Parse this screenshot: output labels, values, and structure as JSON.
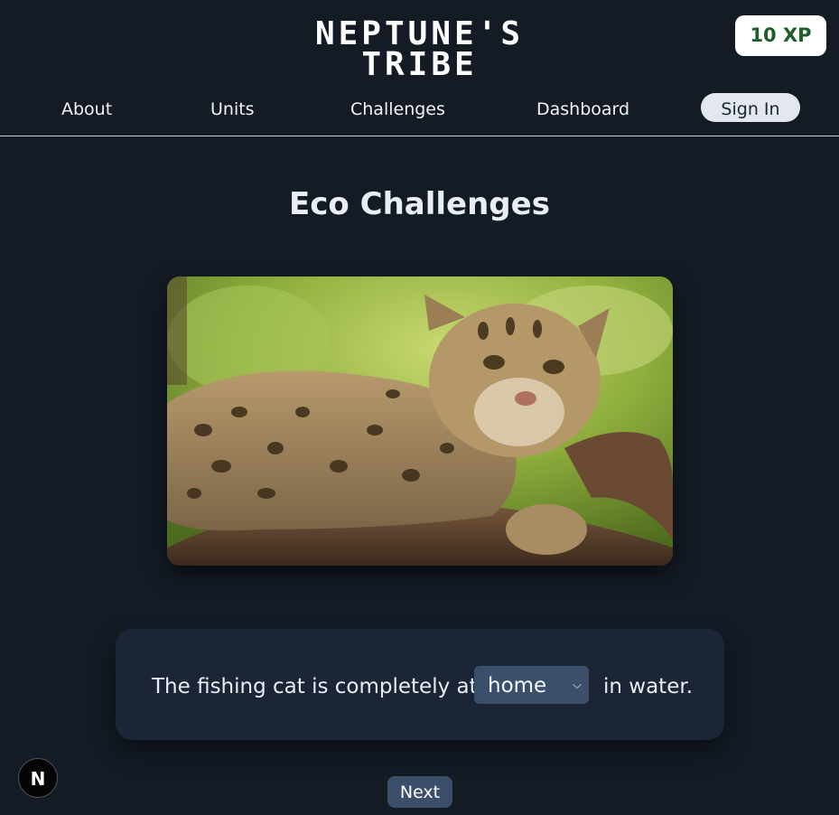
{
  "header": {
    "logo_line1": "NEPTUNE'S",
    "logo_line2": "TRIBE",
    "xp": "10 XP",
    "nav": [
      "About",
      "Units",
      "Challenges",
      "Dashboard"
    ],
    "signin": "Sign In"
  },
  "main": {
    "title": "Eco Challenges",
    "question_prefix": "The fishing cat is completely at",
    "question_suffix": "in water.",
    "select_value": "home",
    "next": "Next"
  },
  "badge": "N",
  "colors": {
    "background": "#141b25",
    "accent": "#3b4f6b",
    "xp_text": "#1d5e2b"
  },
  "icons": {
    "dropdown": "chevron-down-icon",
    "badge": "nextjs-icon"
  }
}
